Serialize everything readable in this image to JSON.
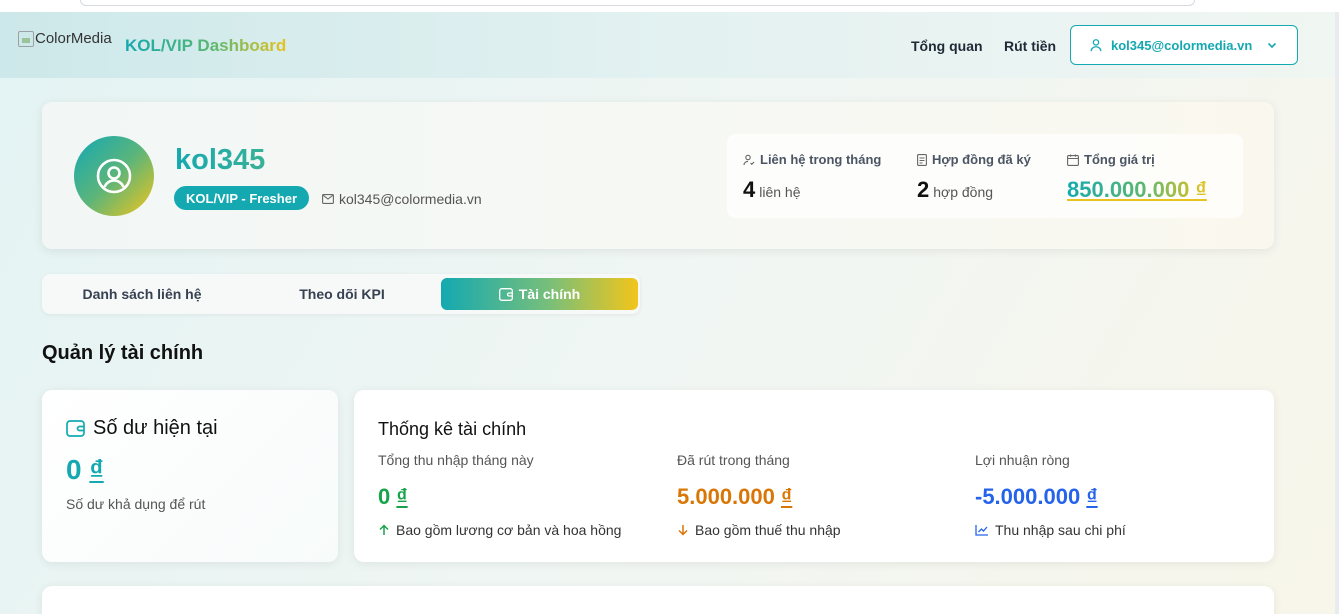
{
  "header": {
    "logo_alt": "ColorMedia",
    "app_title": "KOL/VIP Dashboard",
    "nav": {
      "overview": "Tổng quan",
      "withdraw": "Rút tiền"
    },
    "user_email": "kol345@colormedia.vn"
  },
  "profile": {
    "username": "kol345",
    "level": "KOL/VIP - Fresher",
    "email": "kol345@colormedia.vn",
    "stats": {
      "contacts_label": "Liên hệ trong tháng",
      "contacts_value": "4",
      "contacts_unit": "liên hệ",
      "contracts_label": "Hợp đồng đã ký",
      "contracts_value": "2",
      "contracts_unit": "hợp đồng",
      "total_label": "Tổng giá trị",
      "total_value": "850.000.000 ₫"
    }
  },
  "tabs": {
    "contacts": "Danh sách liên hệ",
    "kpi": "Theo dõi KPI",
    "finance": "Tài chính",
    "active": "finance"
  },
  "section_title": "Quản lý tài chính",
  "balance": {
    "title": "Số dư hiện tại",
    "amount": "0",
    "currency": "₫",
    "note": "Số dư khả dụng để rút"
  },
  "finance_stats": {
    "title": "Thống kê tài chính",
    "income": {
      "label": "Tổng thu nhập tháng này",
      "amount": "0",
      "currency": "₫",
      "note": "Bao gồm lương cơ bản và hoa hồng",
      "color": "#16a34a"
    },
    "withdrawn": {
      "label": "Đã rút trong tháng",
      "amount": "5.000.000",
      "currency": "₫",
      "note": "Bao gồm thuế thu nhập",
      "color": "#d97706"
    },
    "profit": {
      "label": "Lợi nhuận ròng",
      "amount": "-5.000.000",
      "currency": "₫",
      "note": "Thu nhập sau chi phí",
      "color": "#2563eb"
    }
  },
  "colors": {
    "accent": "#14a9b0",
    "gold": "#f2c51a",
    "green": "#16a34a",
    "orange": "#d97706",
    "blue": "#2563eb"
  }
}
